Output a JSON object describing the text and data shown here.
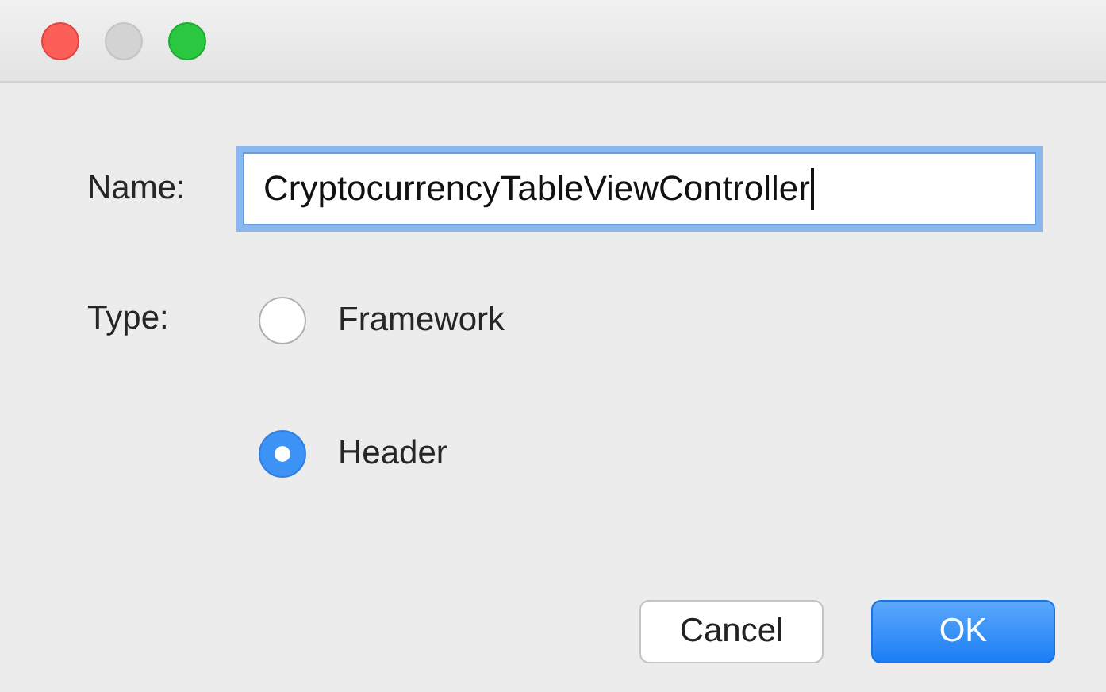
{
  "name_field": {
    "label": "Name:",
    "value": "CryptocurrencyTableViewController",
    "focused": true
  },
  "type_group": {
    "label": "Type:",
    "options": [
      {
        "label": "Framework",
        "selected": false
      },
      {
        "label": "Header",
        "selected": true
      }
    ]
  },
  "buttons": [
    {
      "label": "Cancel",
      "kind": "secondary"
    },
    {
      "label": "OK",
      "kind": "primary"
    }
  ]
}
